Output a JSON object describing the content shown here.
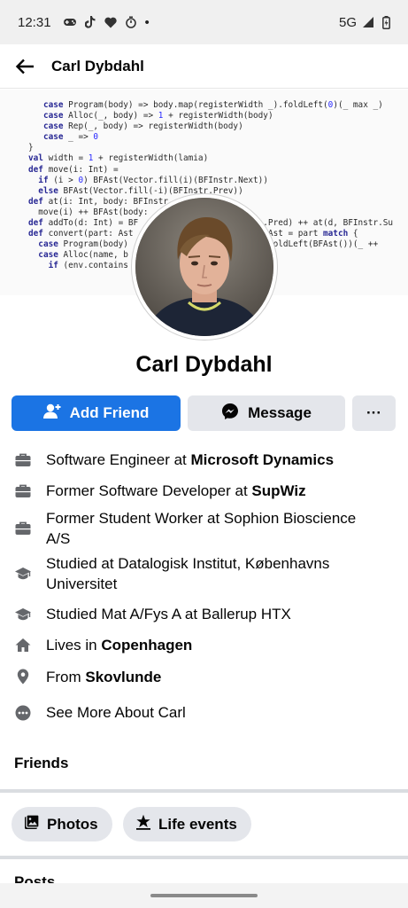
{
  "status_bar": {
    "time": "12:31",
    "dot": "•",
    "network": "5G"
  },
  "header": {
    "title": "Carl Dybdahl"
  },
  "profile": {
    "name": "Carl Dybdahl"
  },
  "actions": {
    "add_friend": "Add Friend",
    "message": "Message",
    "more": "···"
  },
  "details": [
    {
      "icon": "briefcase-icon",
      "prefix": "Software Engineer at ",
      "bold": "Microsoft Dynamics"
    },
    {
      "icon": "briefcase-icon",
      "prefix": "Former Software Developer at ",
      "bold": "SupWiz"
    },
    {
      "icon": "briefcase-icon",
      "prefix": "Former Student Worker at Sophion Bioscience A/S",
      "bold": ""
    },
    {
      "icon": "graduation-cap-icon",
      "prefix": "Studied at Datalogisk Institut, Københavns Universitet",
      "bold": ""
    },
    {
      "icon": "graduation-cap-icon",
      "prefix": "Studied Mat A/Fys A at Ballerup HTX",
      "bold": ""
    },
    {
      "icon": "home-icon",
      "prefix": "Lives in ",
      "bold": "Copenhagen"
    },
    {
      "icon": "location-pin-icon",
      "prefix": "From ",
      "bold": "Skovlunde"
    },
    {
      "icon": "more-dots-icon",
      "prefix": "See More About Carl",
      "bold": ""
    }
  ],
  "friends": {
    "title": "Friends"
  },
  "chips": {
    "photos": "Photos",
    "life_events": "Life events"
  },
  "posts": {
    "title": "Posts"
  },
  "colors": {
    "accent": "#1b74e4",
    "secondary_button": "#e4e6eb",
    "divider": "#dadde1"
  }
}
